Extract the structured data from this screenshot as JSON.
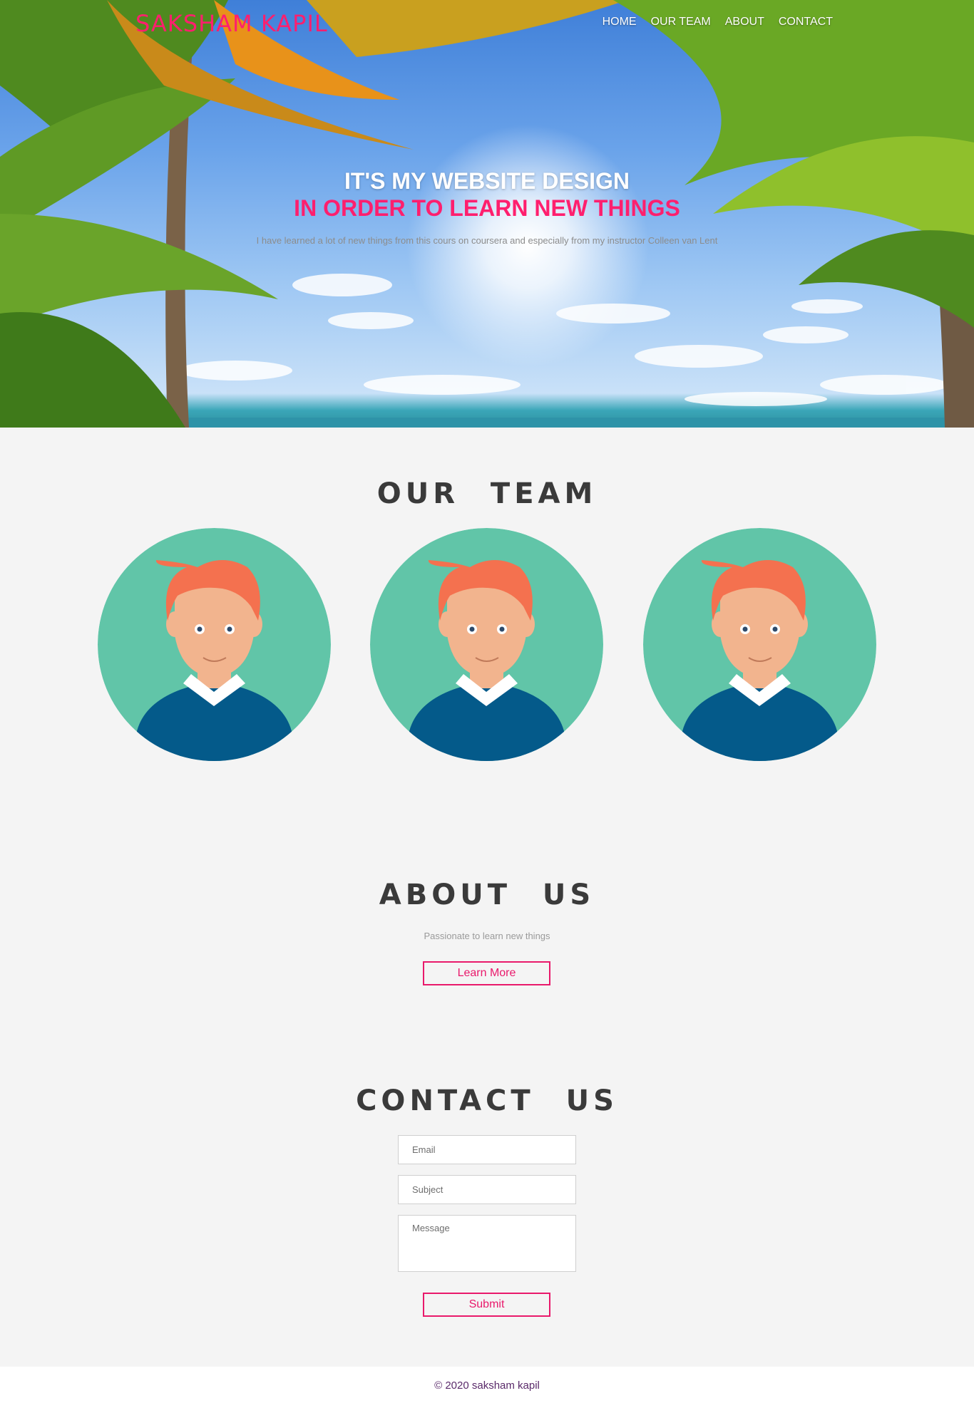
{
  "header": {
    "brand": "SAKSHAM KAPIL",
    "nav": [
      "HOME",
      "OUR TEAM",
      "ABOUT",
      "CONTACT"
    ]
  },
  "hero": {
    "title_line1": "IT'S MY WEBSITE DESIGN",
    "title_line2": "IN ORDER TO LEARN NEW THINGS",
    "subtitle": "I have learned a lot of new things from this cours on coursera and especially from my instructor Colleen van Lent"
  },
  "team": {
    "title": "OUR TEAM"
  },
  "about": {
    "title": "ABOUT US",
    "subtitle": "Passionate to learn new things",
    "button": "Learn More"
  },
  "contact": {
    "title": "CONTACT US",
    "email_placeholder": "Email",
    "subject_placeholder": "Subject",
    "message_placeholder": "Message",
    "submit": "Submit"
  },
  "footer": {
    "text": "© 2020 saksham kapil"
  },
  "colors": {
    "accent": "#ff1f6e",
    "heading": "#3a3a3a",
    "avatar_bg": "#61c5a8",
    "avatar_hair": "#f4714f",
    "avatar_shirt": "#045a8a"
  }
}
